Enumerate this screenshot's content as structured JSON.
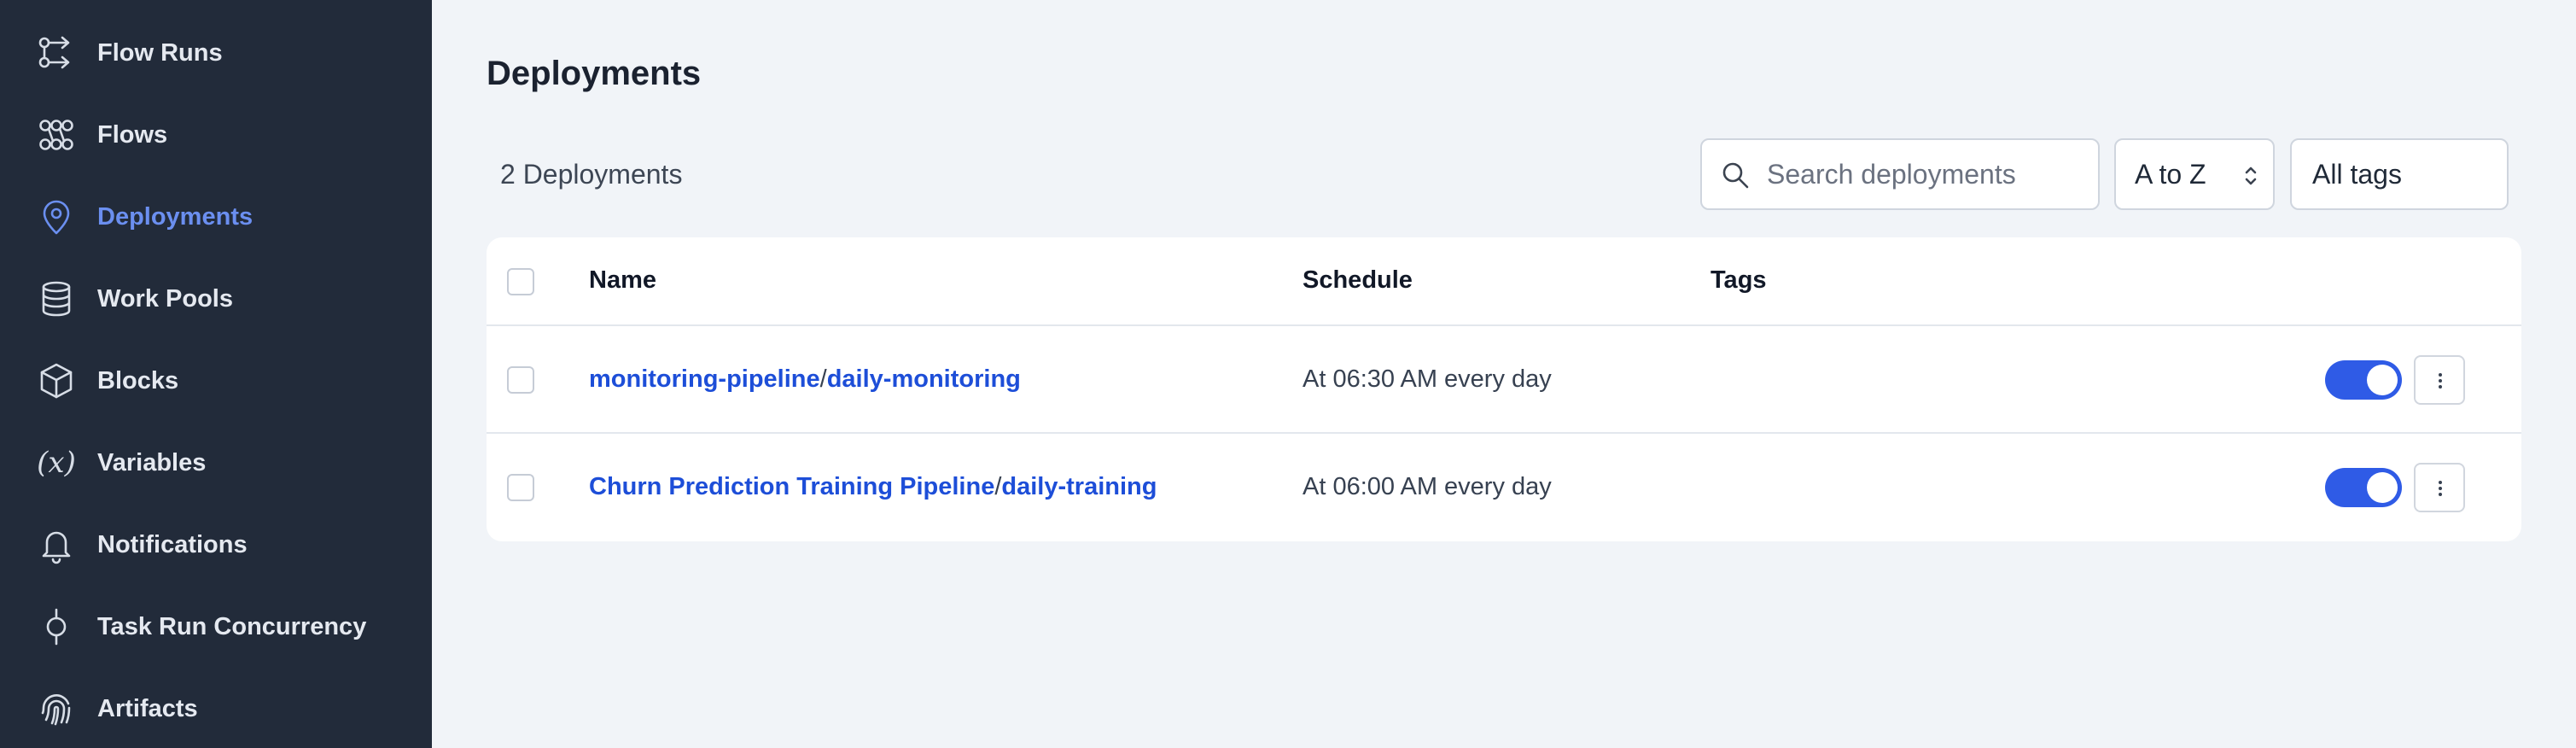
{
  "sidebar": {
    "items": [
      {
        "label": "Flow Runs",
        "icon": "flow-runs-icon",
        "active": false
      },
      {
        "label": "Flows",
        "icon": "flows-icon",
        "active": false
      },
      {
        "label": "Deployments",
        "icon": "map-pin-icon",
        "active": true
      },
      {
        "label": "Work Pools",
        "icon": "database-icon",
        "active": false
      },
      {
        "label": "Blocks",
        "icon": "cube-icon",
        "active": false
      },
      {
        "label": "Variables",
        "icon": "variable-icon",
        "active": false
      },
      {
        "label": "Notifications",
        "icon": "bell-icon",
        "active": false
      },
      {
        "label": "Task Run Concurrency",
        "icon": "concurrency-icon",
        "active": false
      },
      {
        "label": "Artifacts",
        "icon": "fingerprint-icon",
        "active": false
      }
    ],
    "variables_glyph": "(x)"
  },
  "main": {
    "title": "Deployments",
    "count_label": "2 Deployments",
    "search": {
      "placeholder": "Search deployments",
      "value": ""
    },
    "sort": {
      "selected": "A to Z"
    },
    "tags_filter": {
      "selected": "All tags"
    }
  },
  "table": {
    "headers": {
      "name": "Name",
      "schedule": "Schedule",
      "tags": "Tags"
    },
    "rows": [
      {
        "flow_name": "monitoring-pipeline",
        "separator": "/",
        "deployment_name": "daily-monitoring",
        "schedule": "At 06:30 AM every day",
        "tags": "",
        "enabled": true
      },
      {
        "flow_name": "Churn Prediction Training Pipeline",
        "separator": "/",
        "deployment_name": "daily-training",
        "schedule": "At 06:00 AM every day",
        "tags": "",
        "enabled": true
      }
    ]
  },
  "colors": {
    "sidebar_bg": "#222b3a",
    "active_accent": "#6b8ff0",
    "link": "#1d4ed8",
    "toggle_on": "#2f5be6",
    "page_bg": "#f1f4f8"
  }
}
